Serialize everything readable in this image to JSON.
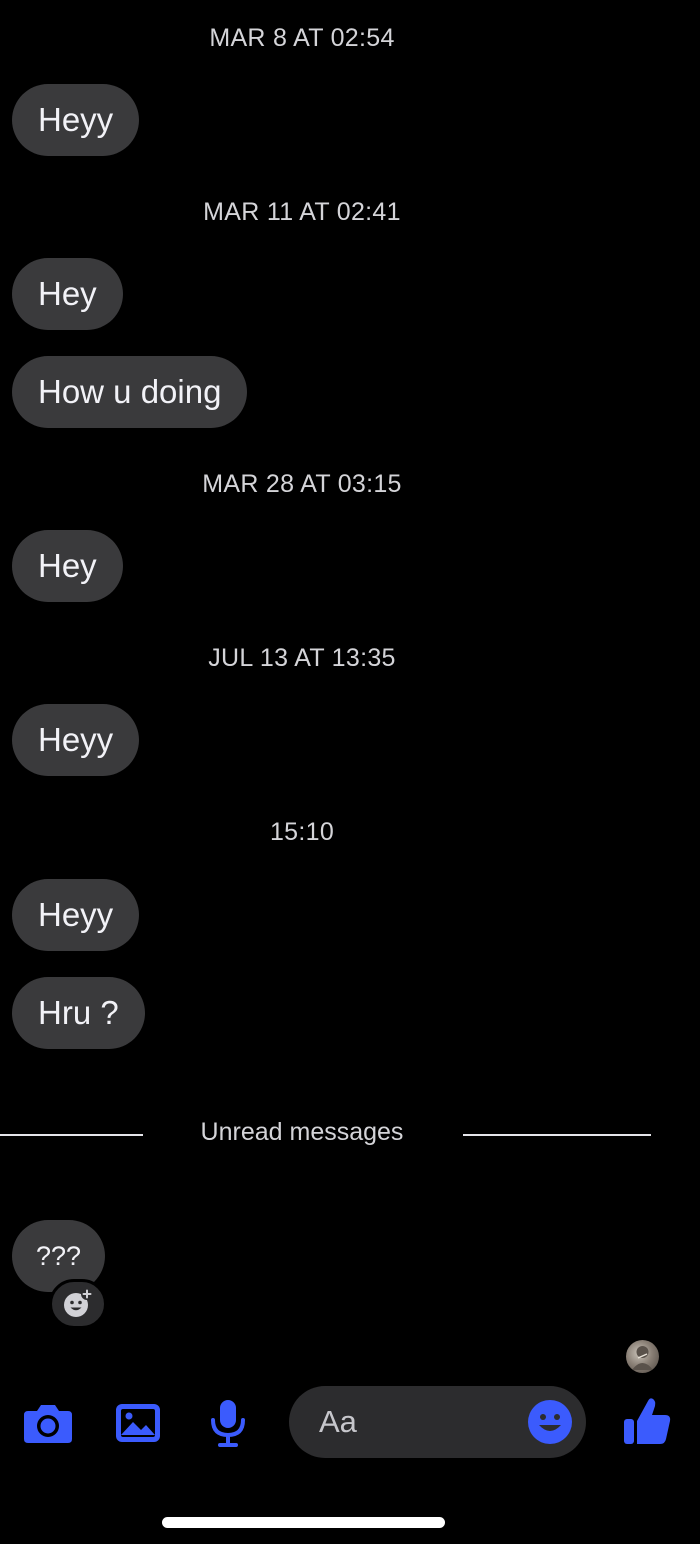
{
  "colors": {
    "background": "#000000",
    "bubble": "#3a3a3c",
    "accent": "#3b5bfd",
    "timestamp": "#d4d4d8"
  },
  "thread": {
    "timestamps": [
      "MAR 8 AT 02:54",
      "MAR 11 AT 02:41",
      "MAR 28 AT 03:15",
      "JUL 13 AT 13:35",
      "15:10"
    ],
    "messages": [
      "Heyy",
      "Hey",
      "How u doing",
      "Hey",
      "Heyy",
      "Heyy",
      "Hru ?",
      "???"
    ],
    "unread_label": "Unread messages"
  },
  "composer": {
    "placeholder": "Aa"
  },
  "icons": {
    "camera": "camera-icon",
    "gallery": "image-icon",
    "mic": "microphone-icon",
    "emoji": "emoji-icon",
    "like": "thumbs-up-icon",
    "reaction": "add-reaction-icon",
    "seen": "seen-avatar"
  }
}
